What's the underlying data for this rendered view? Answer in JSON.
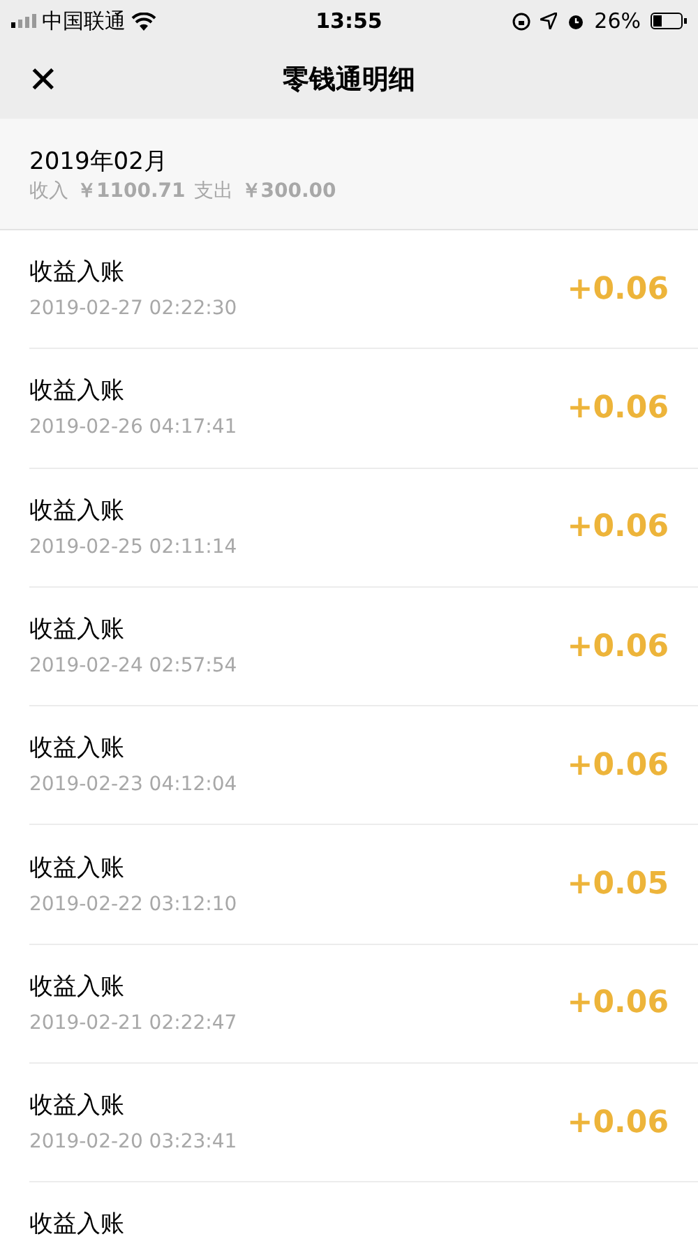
{
  "status_bar": {
    "carrier": "中国联通",
    "time": "13:55",
    "battery": "26%"
  },
  "nav": {
    "close": "✕",
    "title": "零钱通明细"
  },
  "summary": {
    "month": "2019年02月",
    "income_label": "收入",
    "income_amount": "￥1100.71",
    "expense_label": "支出",
    "expense_amount": "￥300.00"
  },
  "transactions": [
    {
      "title": "收益入账",
      "time": "2019-02-27 02:22:30",
      "amount": "+0.06"
    },
    {
      "title": "收益入账",
      "time": "2019-02-26 04:17:41",
      "amount": "+0.06"
    },
    {
      "title": "收益入账",
      "time": "2019-02-25 02:11:14",
      "amount": "+0.06"
    },
    {
      "title": "收益入账",
      "time": "2019-02-24 02:57:54",
      "amount": "+0.06"
    },
    {
      "title": "收益入账",
      "time": "2019-02-23 04:12:04",
      "amount": "+0.06"
    },
    {
      "title": "收益入账",
      "time": "2019-02-22 03:12:10",
      "amount": "+0.05"
    },
    {
      "title": "收益入账",
      "time": "2019-02-21 02:22:47",
      "amount": "+0.06"
    },
    {
      "title": "收益入账",
      "time": "2019-02-20 03:23:41",
      "amount": "+0.06"
    },
    {
      "title": "收益入账"
    }
  ]
}
